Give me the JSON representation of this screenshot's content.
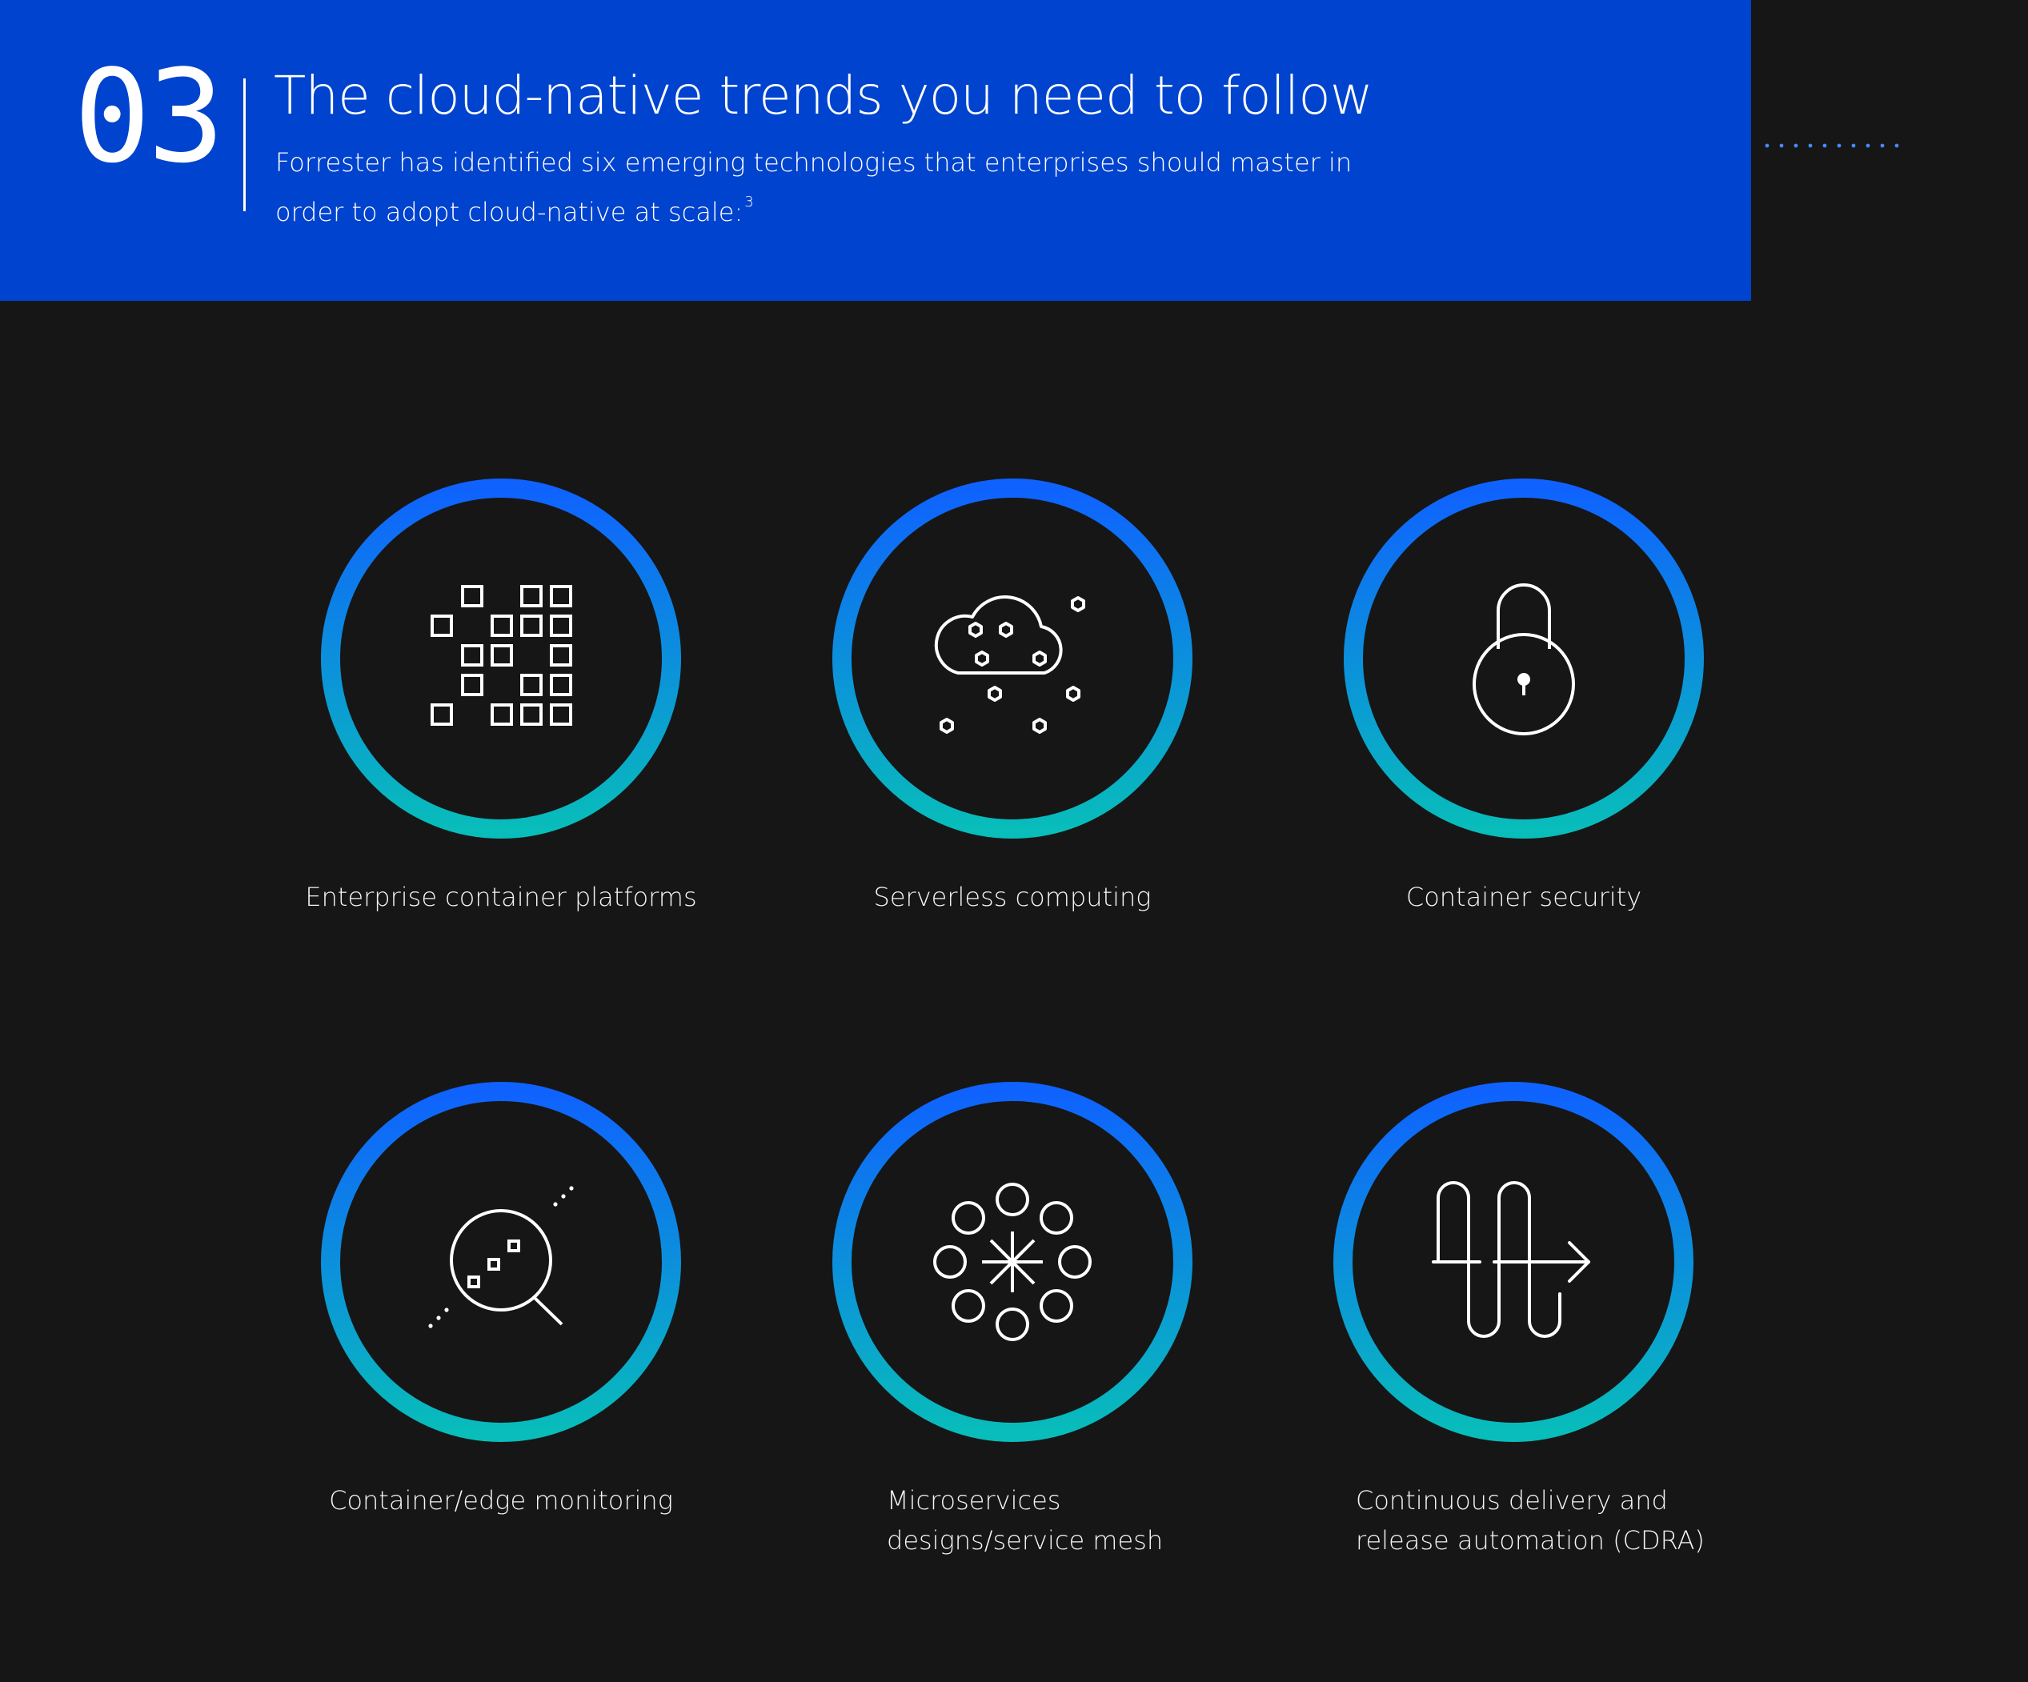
{
  "header": {
    "section_number": "03",
    "title": "The cloud-native trends you need to follow",
    "subtitle": "Forrester has identified six emerging technologies that enterprises should master in order to adopt cloud-native at scale:",
    "footnote": "3"
  },
  "colors": {
    "header_bg": "#0043ce",
    "page_bg": "#161616",
    "ring_top": "#0f62fe",
    "ring_bottom": "#08bdba",
    "dots": "#4589ff"
  },
  "trends": [
    {
      "icon": "container-grid-icon",
      "label": "Enterprise container platforms"
    },
    {
      "icon": "cloud-hexagons-icon",
      "label": "Serverless computing"
    },
    {
      "icon": "padlock-icon",
      "label": "Container security"
    },
    {
      "icon": "magnifier-icon",
      "label": "Container/edge monitoring"
    },
    {
      "icon": "service-mesh-icon",
      "label": "Microservices designs/service mesh"
    },
    {
      "icon": "pipeline-arrow-icon",
      "label": "Continuous delivery and release automation (CDRA)"
    }
  ]
}
